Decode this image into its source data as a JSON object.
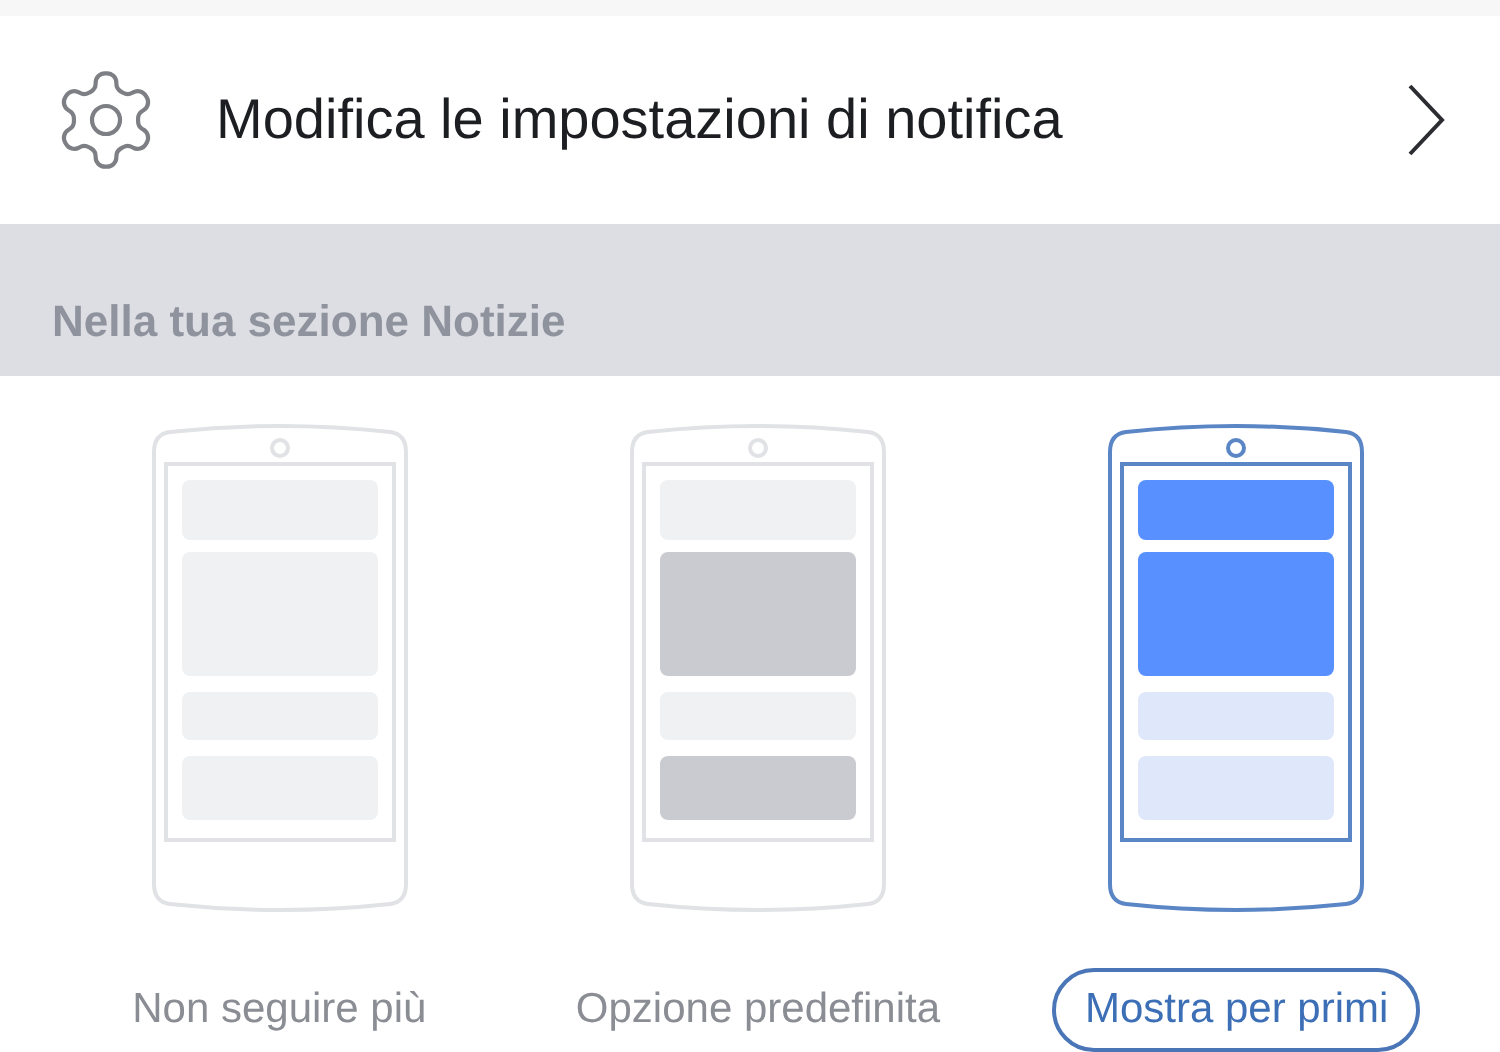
{
  "settings_row": {
    "label": "Modifica le impostazioni di notifica"
  },
  "section": {
    "title": "Nella tua sezione Notizie"
  },
  "options": [
    {
      "kind": "unfollow",
      "label": "Non seguire più",
      "selected": false
    },
    {
      "kind": "default",
      "label": "Opzione predefinita",
      "selected": false
    },
    {
      "kind": "see_first",
      "label": "Mostra per primi",
      "selected": true
    }
  ]
}
